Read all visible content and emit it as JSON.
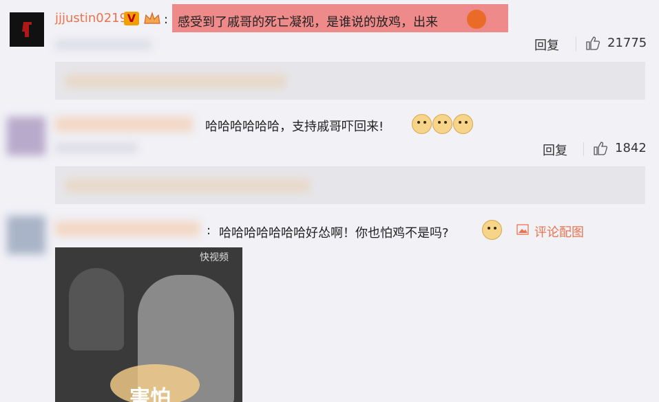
{
  "comment1": {
    "username": "jjjustin0219",
    "verified_badge": "V",
    "text": "感受到了戚哥的死亡凝视，是谁说的放鸡，出来",
    "highlight_color": "#ef8a8a",
    "reply_label": "回复",
    "like_count": "21775"
  },
  "comment2": {
    "text": "哈哈哈哈哈哈，支持戚哥吓回来!",
    "reply_label": "回复",
    "like_count": "1842"
  },
  "comment3": {
    "text": "哈哈哈哈哈哈哈好怂啊！你也怕鸡不是吗?",
    "image_link": "评论配图",
    "image_caption": "害怕",
    "watermark": "快视频"
  },
  "colors": {
    "accent": "#eb7350",
    "link": "#eb7350",
    "background": "#f1f1f6"
  },
  "icons": [
    "thumbs-up-icon",
    "image-icon",
    "dog-emoji-icon",
    "verified-icon",
    "crown-icon"
  ]
}
